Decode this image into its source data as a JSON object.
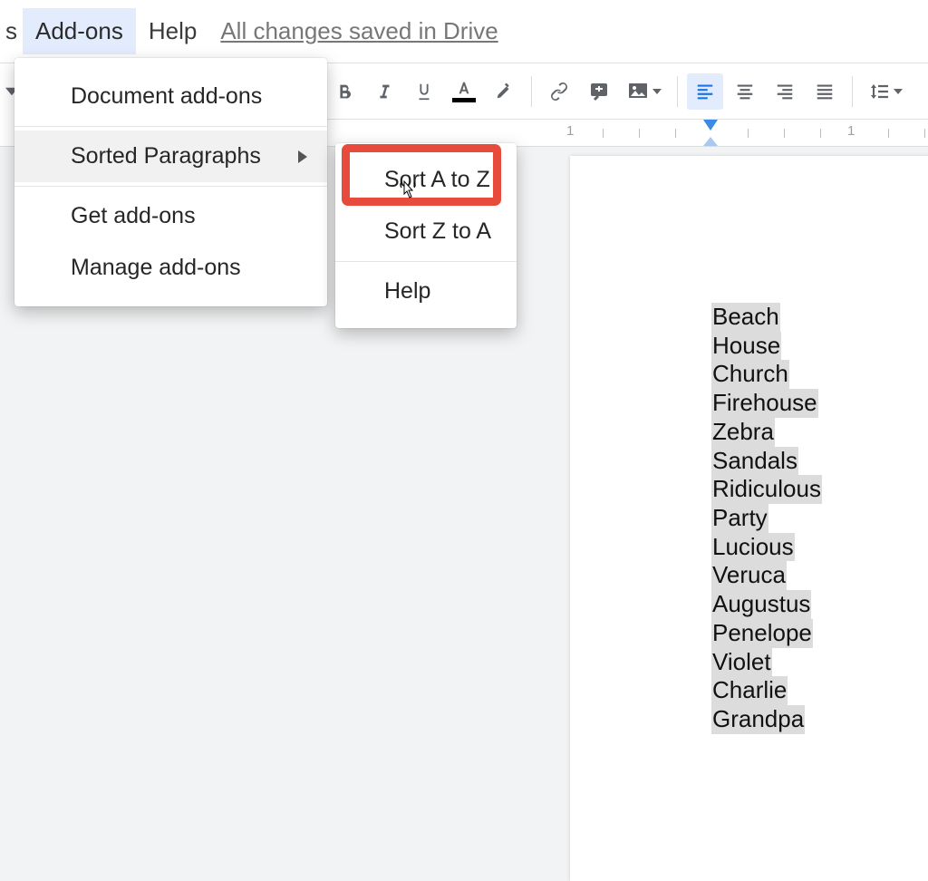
{
  "menubar": {
    "fragment": "s",
    "addons": "Add-ons",
    "help": "Help",
    "status": "All changes saved in Drive"
  },
  "dropdown": {
    "document_addons": "Document add-ons",
    "sorted_paragraphs": "Sorted Paragraphs",
    "get_addons": "Get add-ons",
    "manage_addons": "Manage add-ons"
  },
  "submenu": {
    "sort_az": "Sort A to Z",
    "sort_za": "Sort Z to A",
    "help": "Help"
  },
  "ruler": {
    "label1": "1",
    "label2": "1"
  },
  "document": {
    "paragraphs": [
      "Beach",
      "House",
      "Church",
      "Firehouse",
      "Zebra",
      "Sandals",
      "Ridiculous",
      "Party",
      "Lucious",
      "Veruca",
      "Augustus",
      "Penelope",
      "Violet",
      "Charlie",
      "Grandpa"
    ]
  }
}
